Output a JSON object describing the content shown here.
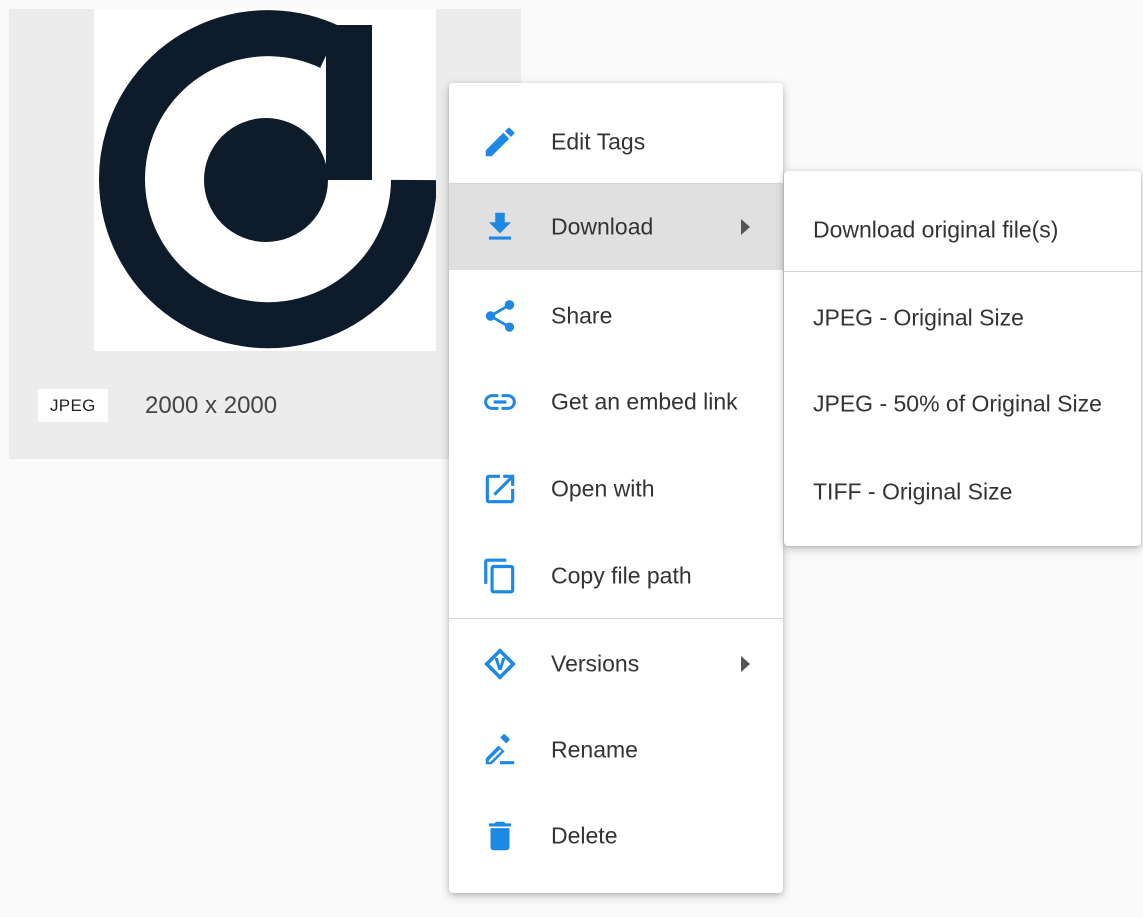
{
  "asset": {
    "file_type": "JPEG",
    "dimensions": "2000 x 2000"
  },
  "colors": {
    "accent": "#1e88e5",
    "logo": "#0d1b2a",
    "active_bg": "#e0e0e0"
  },
  "menu": {
    "items": [
      {
        "label": "Edit Tags",
        "icon": "pencil-icon"
      },
      {
        "label": "Download",
        "icon": "download-icon",
        "submenu": true,
        "active": true
      },
      {
        "label": "Share",
        "icon": "share-icon"
      },
      {
        "label": "Get an embed link",
        "icon": "link-icon"
      },
      {
        "label": "Open with",
        "icon": "open-external-icon"
      },
      {
        "label": "Copy file path",
        "icon": "copy-icon"
      },
      {
        "label": "Versions",
        "icon": "versions-icon",
        "submenu": true
      },
      {
        "label": "Rename",
        "icon": "rename-icon"
      },
      {
        "label": "Delete",
        "icon": "trash-icon"
      }
    ]
  },
  "download_submenu": {
    "items": [
      {
        "label": "Download original file(s)"
      },
      {
        "label": "JPEG - Original Size"
      },
      {
        "label": "JPEG - 50% of Original Size"
      },
      {
        "label": "TIFF - Original Size"
      }
    ]
  }
}
